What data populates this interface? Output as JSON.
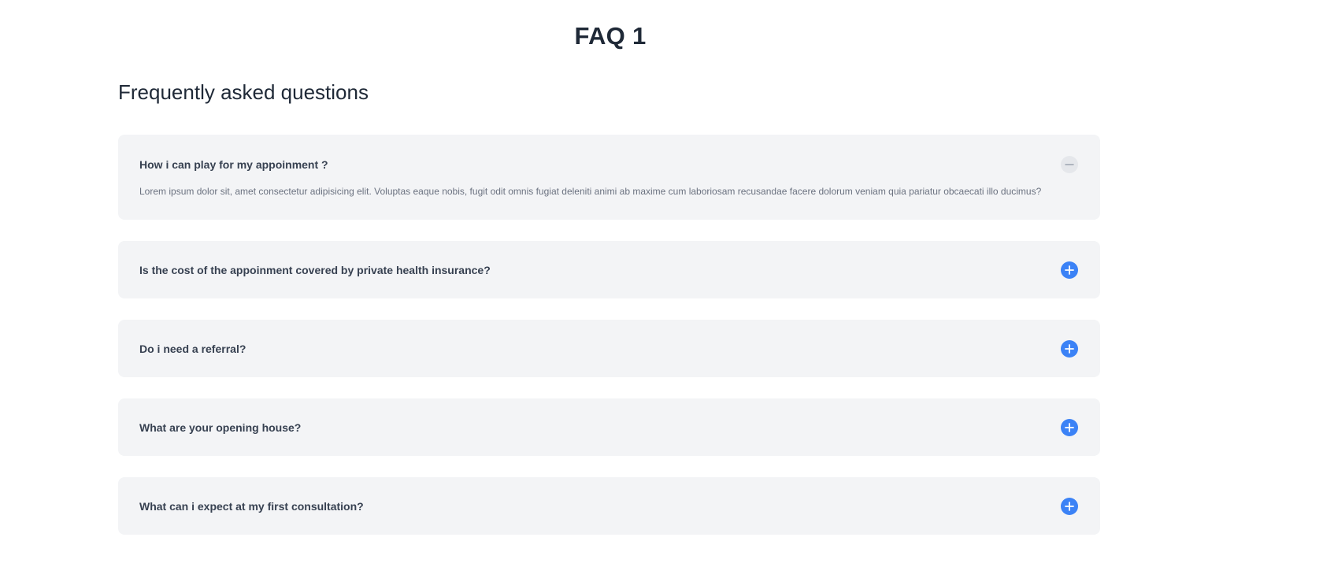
{
  "page": {
    "title": "FAQ 1",
    "heading": "Frequently asked questions"
  },
  "faq": {
    "items": [
      {
        "question": "How i can play for my appoinment ?",
        "answer": "Lorem ipsum dolor sit, amet consectetur adipisicing elit. Voluptas eaque nobis, fugit odit omnis fugiat deleniti animi ab maxime cum laboriosam recusandae facere dolorum veniam quia pariatur obcaecati illo ducimus?",
        "expanded": true,
        "icon": "minus-circle-icon"
      },
      {
        "question": "Is the cost of the appoinment covered by private health insurance?",
        "expanded": false,
        "icon": "plus-circle-icon"
      },
      {
        "question": "Do i need a referral?",
        "expanded": false,
        "icon": "plus-circle-icon"
      },
      {
        "question": "What are your opening house?",
        "expanded": false,
        "icon": "plus-circle-icon"
      },
      {
        "question": "What can i expect at my first consultation?",
        "expanded": false,
        "icon": "plus-circle-icon"
      }
    ]
  },
  "colors": {
    "accent": "#3b82f6",
    "card_background": "#f3f4f6",
    "collapse_icon_background": "#e5e7eb",
    "text_dark": "#1f2937",
    "text_muted": "#6b7280"
  }
}
